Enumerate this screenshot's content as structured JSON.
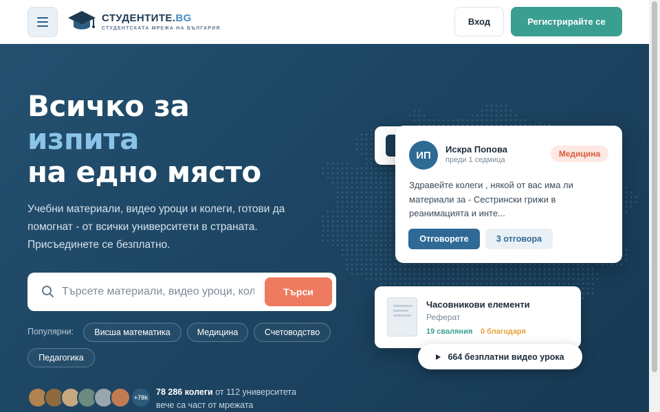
{
  "header": {
    "menu_icon": "hamburger-icon",
    "logo_icon": "graduation-cap-icon",
    "logo_title_main": "СТУДЕНТИТЕ.",
    "logo_title_accent": "BG",
    "logo_subtitle": "СТУДЕНТСКАТА МРЕЖА НА БЪЛГАРИЯ",
    "login_label": "Вход",
    "register_label": "Регистрирайте се"
  },
  "hero": {
    "title_line1": "Всичко за",
    "title_line2": "изпита",
    "title_line3": "на едно място",
    "lead": "Учебни материали, видео уроци и колеги, готови да помогнат - от всички университети в страната. Присъединете се безплатно.",
    "search": {
      "icon": "search-icon",
      "placeholder": "Търсете материали, видео уроци, колеги...",
      "button_label": "Търси"
    },
    "popular_label": "Популярни:",
    "popular_tags": [
      "Висша математика",
      "Медицина",
      "Счетоводство",
      "Педагогика"
    ],
    "avatar_count_label": "+78k",
    "stats_strong": "78 286 колеги",
    "stats_rest": " от 112 университета",
    "stats_line2": "вече са част от мрежата"
  },
  "question_card": {
    "avatar_initials": "ИП",
    "author": "Искра Попова",
    "time": "преди 1 седмица",
    "tag": "Медицина",
    "text": "Здравейте колеги , някой от вас има ли материали за - Сестрински грижи в реанимацията и инте...",
    "answer_label": "Отговорете",
    "answers_count_label": "3 отговора"
  },
  "document_card": {
    "thumb_icon": "document-icon",
    "title": "Часовникови елементи",
    "type": "Реферат",
    "downloads": "19 сваляния",
    "thanks": "0 благодаря"
  },
  "video_pill": {
    "icon": "play-icon",
    "label": "664 безплатни видео урока"
  },
  "colors": {
    "accent_teal": "#3a9f91",
    "accent_orange": "#ee7a5f",
    "hero_background": "#1d4563",
    "highlight_blue": "#8ac4e8"
  }
}
